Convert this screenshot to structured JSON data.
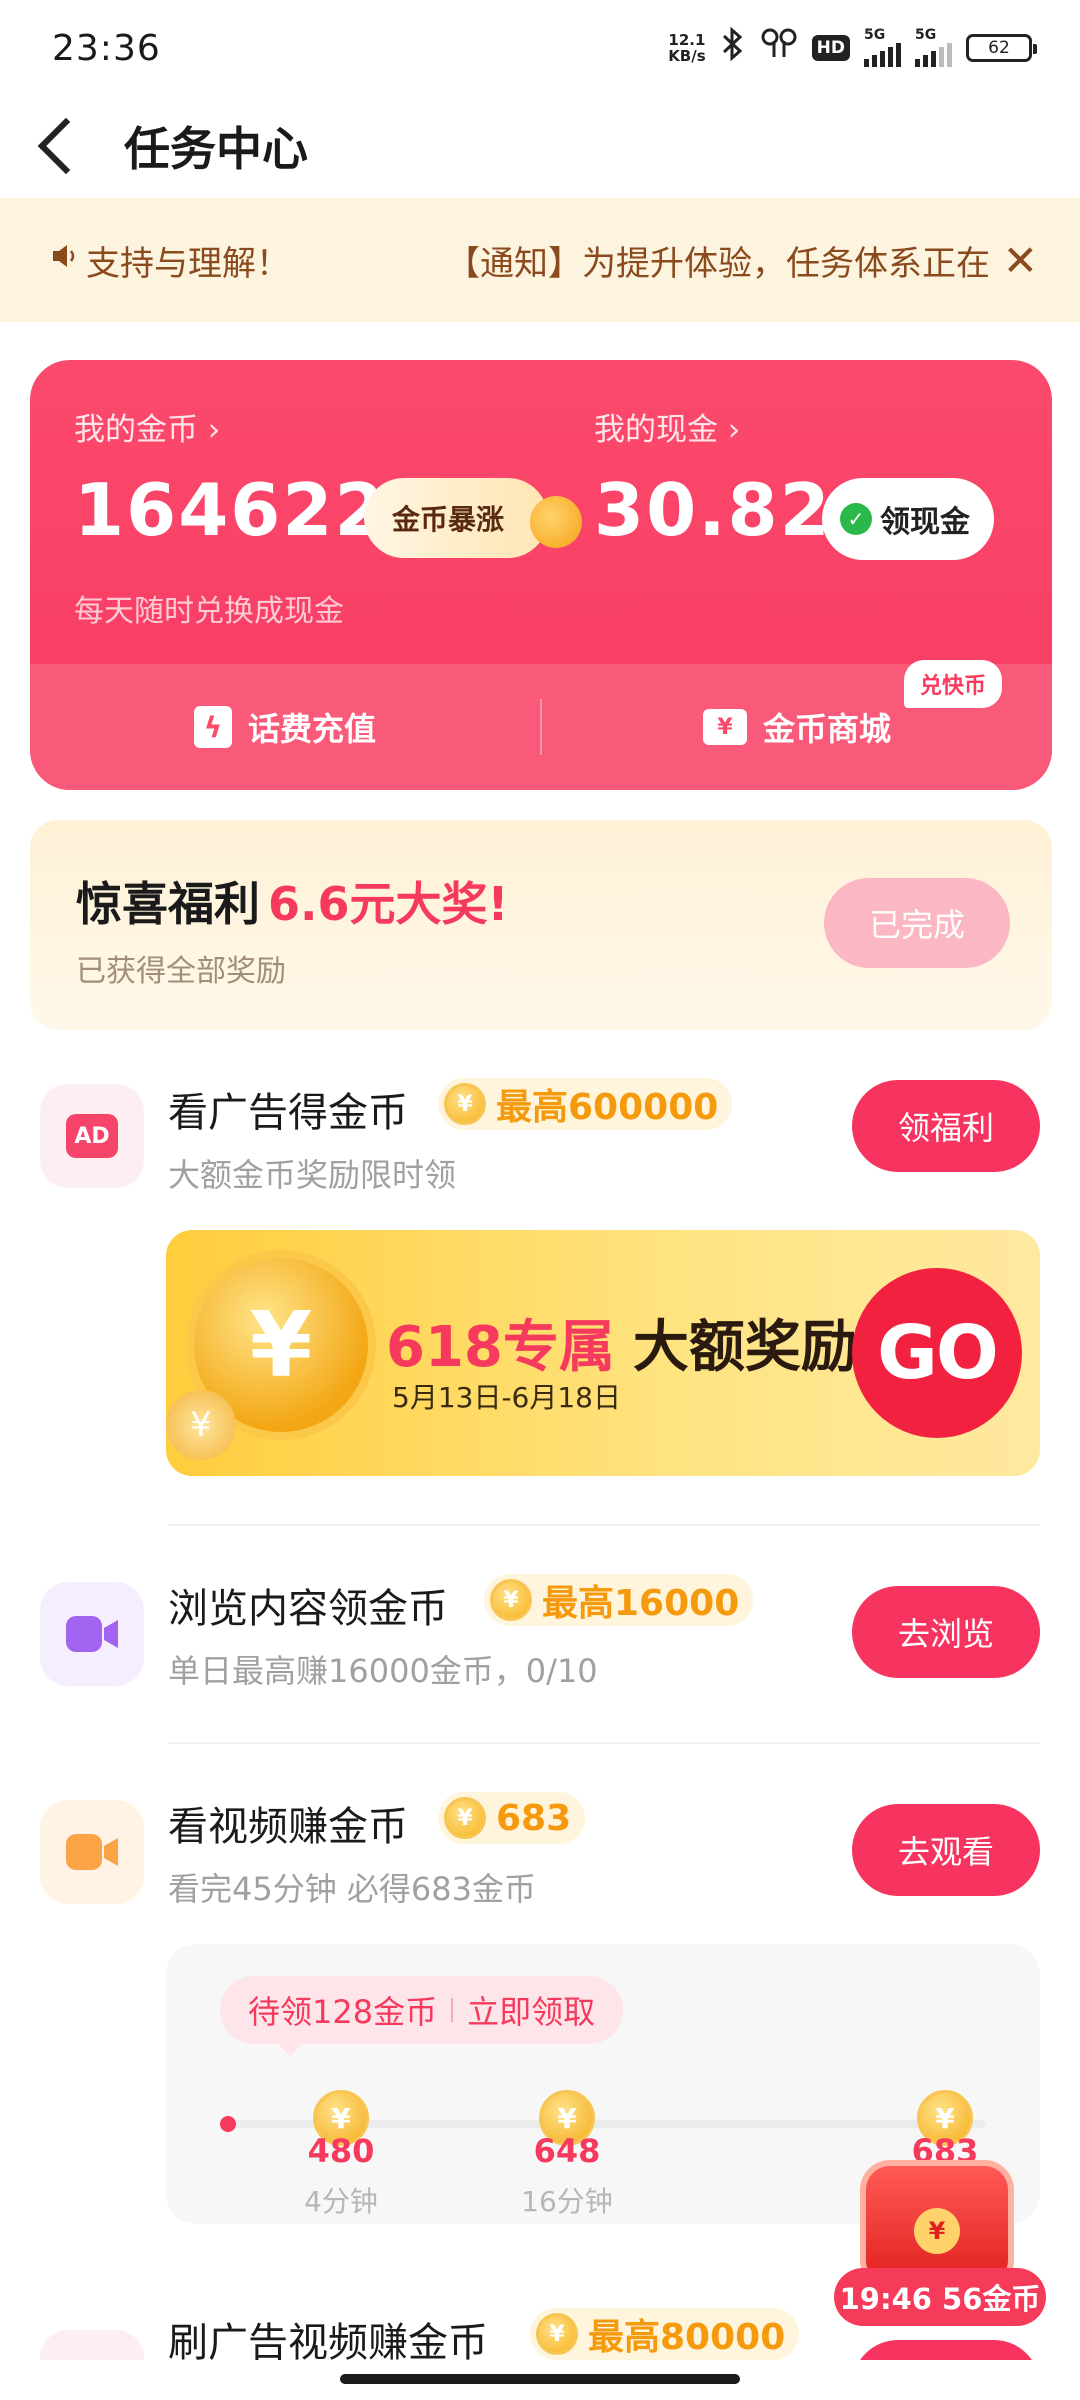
{
  "status_bar": {
    "time": "23:36",
    "net_speed_top": "12.1",
    "net_speed_bottom": "KB/s",
    "bluetooth_icon": "bluetooth-icon",
    "earbuds_icon": "earbuds-icon",
    "hd_badge": "HD",
    "sim1_label": "5G",
    "sim2_label": "5G",
    "battery": "62"
  },
  "header": {
    "title": "任务中心"
  },
  "notice": {
    "text_a": "支持与理解！",
    "text_b": "【通知】为提升体验，任务体系正在"
  },
  "wallet": {
    "coins_label": "我的金币 ›",
    "coins_value": "164622",
    "boost_label": "金币暴涨",
    "cash_label": "我的现金 ›",
    "cash_value": "30.82",
    "withdraw_label": "领现金",
    "hint": "每天随时兑换成现金",
    "recharge_label": "话费充值",
    "mall_label": "金币商城",
    "exchange_tag": "兑快币"
  },
  "surprise": {
    "title": "惊喜福利",
    "highlight": "6.6元大奖!",
    "subtitle": "已获得全部奖励",
    "button": "已完成"
  },
  "tasks": [
    {
      "title": "看广告得金币",
      "coin_text": "最高600000",
      "subtitle": "大额金币奖励限时领",
      "button": "领福利",
      "icon_label": "AD"
    },
    {
      "title": "浏览内容领金币",
      "coin_text": "最高16000",
      "subtitle": "单日最高赚16000金币，0/10",
      "button": "去浏览"
    },
    {
      "title": "看视频赚金币",
      "coin_text": "683",
      "subtitle": "看完45分钟 必得683金币",
      "button": "去观看"
    },
    {
      "title": "刷广告视频赚金币",
      "coin_text": "最高80000"
    }
  ],
  "banner": {
    "title_red": "618专属",
    "title_dark": "大额奖励",
    "date": "5月13日-6月18日",
    "go": "GO"
  },
  "video_progress": {
    "claim_left": "待领128金币",
    "claim_right": "立即领取",
    "milestones": [
      {
        "value": "480",
        "time": "4分钟"
      },
      {
        "value": "648",
        "time": "16分钟"
      },
      {
        "value": "683",
        "time": ""
      }
    ]
  },
  "floating_chest": {
    "timer": "19:46 56金币"
  },
  "colors": {
    "primary": "#f7345f",
    "wallet_bg": "#fb4a6c",
    "coin_gold": "#f59a0c",
    "notice_bg": "#fdf4e0"
  }
}
